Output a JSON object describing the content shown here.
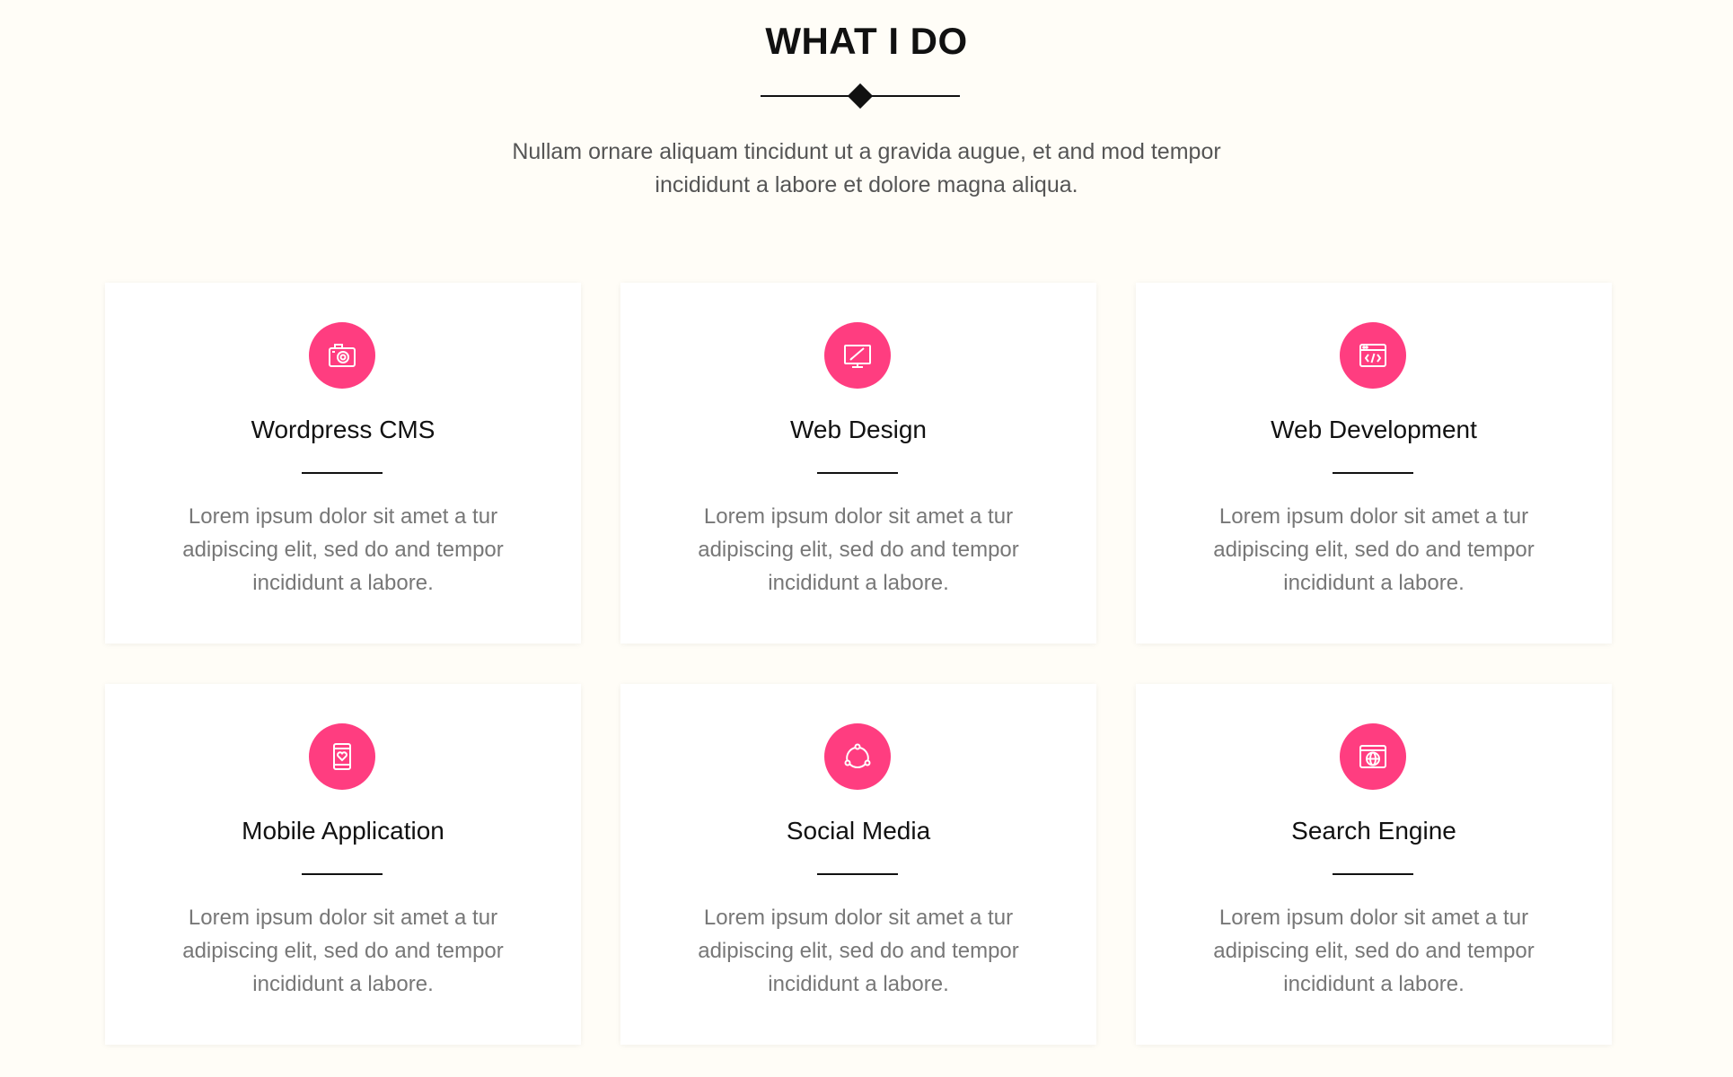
{
  "section": {
    "title": "WHAT I DO",
    "intro": "Nullam ornare aliquam tincidunt ut a gravida augue, et and mod tempor incididunt a labore et dolore magna aliqua."
  },
  "colors": {
    "accent": "#ff3d80",
    "background": "#fffdf7",
    "card": "#ffffff"
  },
  "services": [
    {
      "title": "Wordpress CMS",
      "icon": "camera-icon",
      "text": "Lorem ipsum dolor sit amet a tur adipiscing elit, sed do and tempor incididunt a labore."
    },
    {
      "title": "Web Design",
      "icon": "monitor-pen-icon",
      "text": "Lorem ipsum dolor sit amet a tur adipiscing elit, sed do and tempor incididunt a labore."
    },
    {
      "title": "Web Development",
      "icon": "code-window-icon",
      "text": "Lorem ipsum dolor sit amet a tur adipiscing elit, sed do and tempor incididunt a labore."
    },
    {
      "title": "Mobile Application",
      "icon": "mobile-heart-icon",
      "text": "Lorem ipsum dolor sit amet a tur adipiscing elit, sed do and tempor incididunt a labore."
    },
    {
      "title": "Social Media",
      "icon": "share-network-icon",
      "text": "Lorem ipsum dolor sit amet a tur adipiscing elit, sed do and tempor incididunt a labore."
    },
    {
      "title": "Search Engine",
      "icon": "globe-window-icon",
      "text": "Lorem ipsum dolor sit amet a tur adipiscing elit, sed do and tempor incididunt a labore."
    }
  ]
}
